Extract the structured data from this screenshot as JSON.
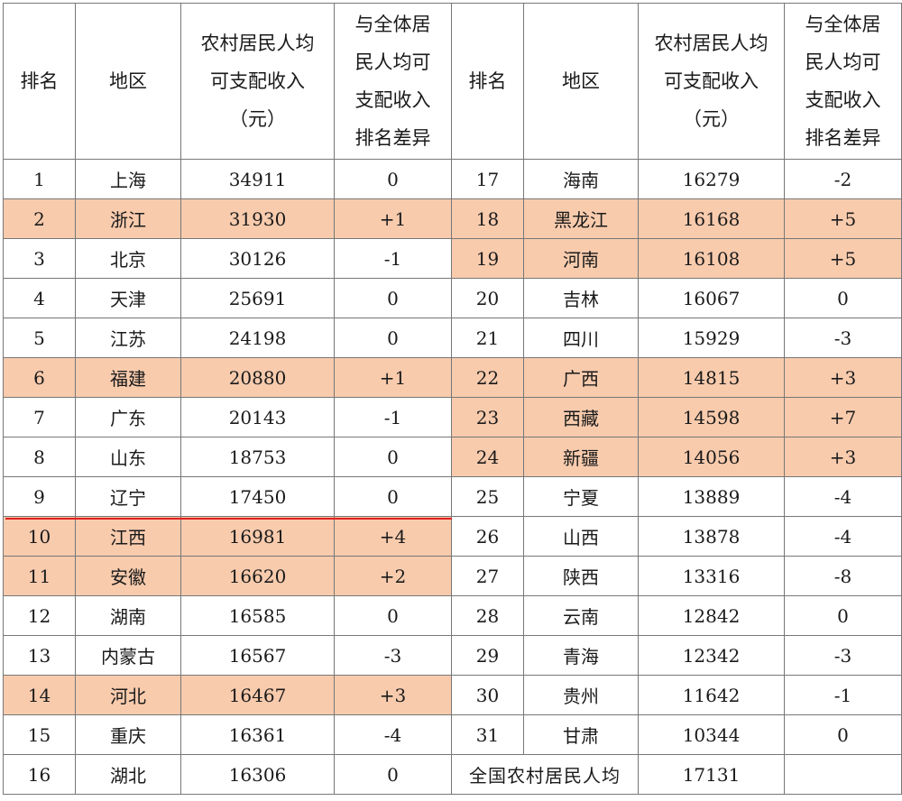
{
  "header": {
    "rank": "排名",
    "region": "地区",
    "income_lines": [
      "农村居民人均",
      "可支配收入",
      "（元）"
    ],
    "diff_lines": [
      "与全体居",
      "民人均可",
      "支配收入",
      "排名差异"
    ]
  },
  "rows": [
    {
      "l": {
        "rank": "1",
        "region": "上海",
        "income": "34911",
        "diff": "0",
        "hl": false
      },
      "r": {
        "rank": "17",
        "region": "海南",
        "income": "16279",
        "diff": "-2",
        "hl": false
      }
    },
    {
      "l": {
        "rank": "2",
        "region": "浙江",
        "income": "31930",
        "diff": "+1",
        "hl": true
      },
      "r": {
        "rank": "18",
        "region": "黑龙江",
        "income": "16168",
        "diff": "+5",
        "hl": true
      }
    },
    {
      "l": {
        "rank": "3",
        "region": "北京",
        "income": "30126",
        "diff": "-1",
        "hl": false
      },
      "r": {
        "rank": "19",
        "region": "河南",
        "income": "16108",
        "diff": "+5",
        "hl": true
      }
    },
    {
      "l": {
        "rank": "4",
        "region": "天津",
        "income": "25691",
        "diff": "0",
        "hl": false
      },
      "r": {
        "rank": "20",
        "region": "吉林",
        "income": "16067",
        "diff": "0",
        "hl": false
      }
    },
    {
      "l": {
        "rank": "5",
        "region": "江苏",
        "income": "24198",
        "diff": "0",
        "hl": false
      },
      "r": {
        "rank": "21",
        "region": "四川",
        "income": "15929",
        "diff": "-3",
        "hl": false
      }
    },
    {
      "l": {
        "rank": "6",
        "region": "福建",
        "income": "20880",
        "diff": "+1",
        "hl": true
      },
      "r": {
        "rank": "22",
        "region": "广西",
        "income": "14815",
        "diff": "+3",
        "hl": true
      }
    },
    {
      "l": {
        "rank": "7",
        "region": "广东",
        "income": "20143",
        "diff": "-1",
        "hl": false
      },
      "r": {
        "rank": "23",
        "region": "西藏",
        "income": "14598",
        "diff": "+7",
        "hl": true
      }
    },
    {
      "l": {
        "rank": "8",
        "region": "山东",
        "income": "18753",
        "diff": "0",
        "hl": false
      },
      "r": {
        "rank": "24",
        "region": "新疆",
        "income": "14056",
        "diff": "+3",
        "hl": true
      }
    },
    {
      "l": {
        "rank": "9",
        "region": "辽宁",
        "income": "17450",
        "diff": "0",
        "hl": false
      },
      "r": {
        "rank": "25",
        "region": "宁夏",
        "income": "13889",
        "diff": "-4",
        "hl": false
      }
    },
    {
      "l": {
        "rank": "10",
        "region": "江西",
        "income": "16981",
        "diff": "+4",
        "hl": true
      },
      "r": {
        "rank": "26",
        "region": "山西",
        "income": "13878",
        "diff": "-4",
        "hl": false
      }
    },
    {
      "l": {
        "rank": "11",
        "region": "安徽",
        "income": "16620",
        "diff": "+2",
        "hl": true
      },
      "r": {
        "rank": "27",
        "region": "陕西",
        "income": "13316",
        "diff": "-8",
        "hl": false
      }
    },
    {
      "l": {
        "rank": "12",
        "region": "湖南",
        "income": "16585",
        "diff": "0",
        "hl": false
      },
      "r": {
        "rank": "28",
        "region": "云南",
        "income": "12842",
        "diff": "0",
        "hl": false
      }
    },
    {
      "l": {
        "rank": "13",
        "region": "内蒙古",
        "income": "16567",
        "diff": "-3",
        "hl": false
      },
      "r": {
        "rank": "29",
        "region": "青海",
        "income": "12342",
        "diff": "-3",
        "hl": false
      }
    },
    {
      "l": {
        "rank": "14",
        "region": "河北",
        "income": "16467",
        "diff": "+3",
        "hl": true
      },
      "r": {
        "rank": "30",
        "region": "贵州",
        "income": "11642",
        "diff": "-1",
        "hl": false
      }
    },
    {
      "l": {
        "rank": "15",
        "region": "重庆",
        "income": "16361",
        "diff": "-4",
        "hl": false
      },
      "r": {
        "rank": "31",
        "region": "甘肃",
        "income": "10344",
        "diff": "0",
        "hl": false
      }
    },
    {
      "l": {
        "rank": "16",
        "region": "湖北",
        "income": "16306",
        "diff": "0",
        "hl": false
      },
      "r": {
        "label": "全国农村居民人均",
        "income": "17131",
        "diff": "",
        "hl": false
      }
    }
  ],
  "colors": {
    "highlight": "#f8cbad",
    "divider": "#e02020",
    "grid": "#777777"
  },
  "divider_after_rank": 9
}
